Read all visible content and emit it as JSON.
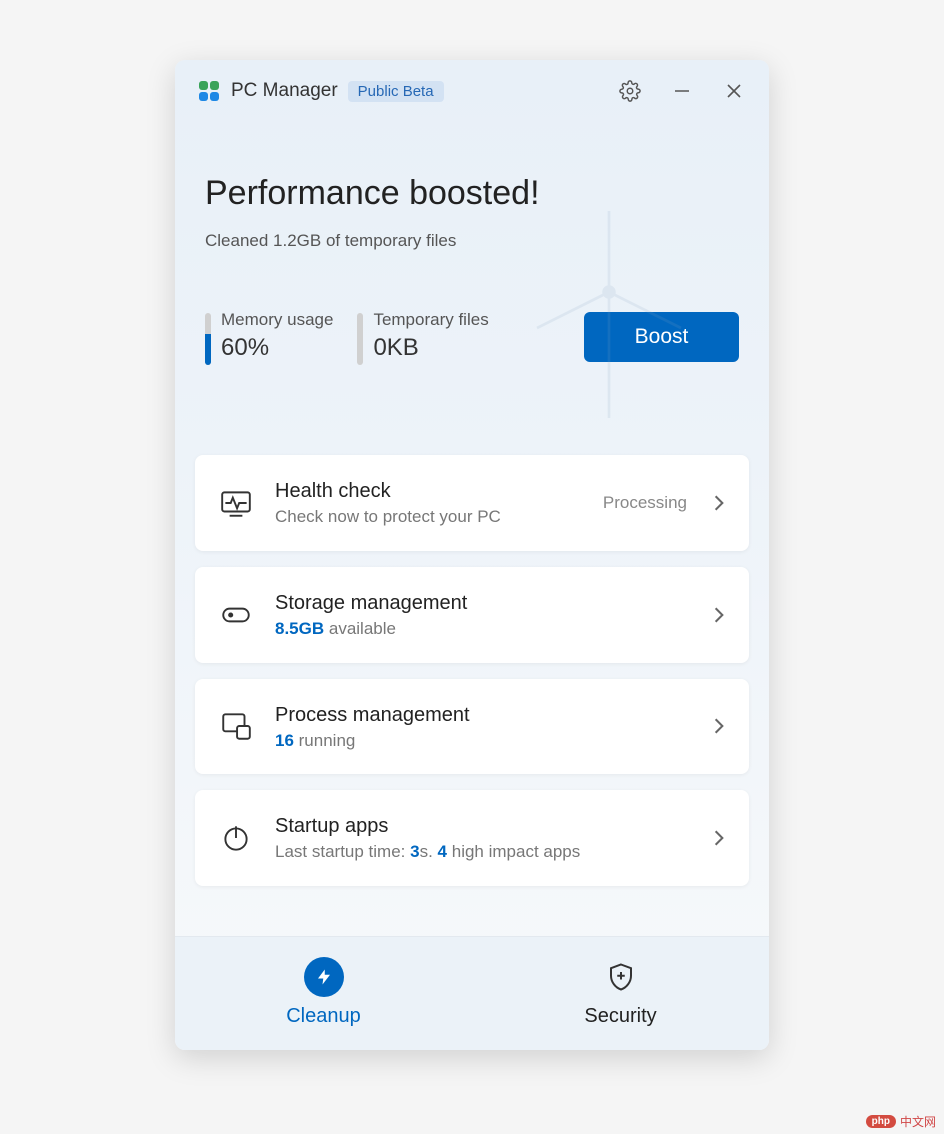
{
  "app": {
    "title": "PC Manager",
    "badge": "Public Beta"
  },
  "hero": {
    "title": "Performance boosted!",
    "subtitle": "Cleaned 1.2GB of temporary files"
  },
  "stats": {
    "memory": {
      "label": "Memory usage",
      "value": "60%"
    },
    "temp": {
      "label": "Temporary files",
      "value": "0KB"
    },
    "boost_label": "Boost"
  },
  "cards": {
    "health": {
      "title": "Health check",
      "subtitle": "Check now to protect your PC",
      "status": "Processing"
    },
    "storage": {
      "title": "Storage management",
      "value": "8.5GB",
      "suffix": " available"
    },
    "process": {
      "title": "Process management",
      "value": "16",
      "suffix": " running"
    },
    "startup": {
      "title": "Startup apps",
      "sub_prefix": "Last startup time: ",
      "time_value": "3",
      "time_unit": "s. ",
      "impact_count": "4",
      "impact_suffix": " high impact apps"
    }
  },
  "tabs": {
    "cleanup": "Cleanup",
    "security": "Security"
  },
  "watermark": {
    "badge": "php",
    "text": "中文网"
  }
}
